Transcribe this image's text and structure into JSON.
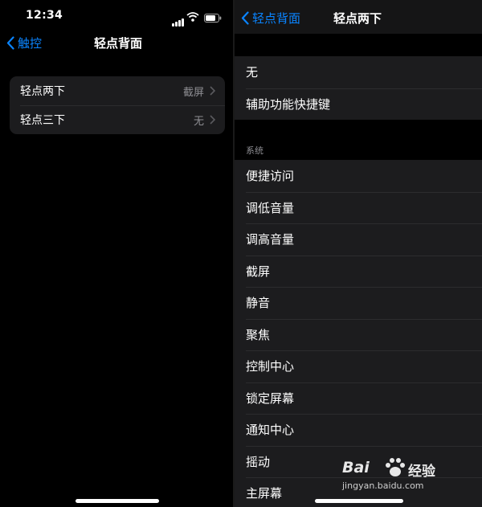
{
  "left": {
    "status": {
      "time": "12:34"
    },
    "nav": {
      "back_label": "触控",
      "title": "轻点背面"
    },
    "rows": [
      {
        "label": "轻点两下",
        "value": "截屏"
      },
      {
        "label": "轻点三下",
        "value": "无"
      }
    ]
  },
  "right": {
    "nav": {
      "back_label": "轻点背面",
      "title": "轻点两下"
    },
    "top_options": [
      "无",
      "辅助功能快捷键"
    ],
    "section_header": "系统",
    "system_options": [
      "便捷访问",
      "调低音量",
      "调高音量",
      "截屏",
      "静音",
      "聚焦",
      "控制中心",
      "锁定屏幕",
      "通知中心",
      "摇动",
      "主屏幕"
    ]
  },
  "watermark": {
    "logo": "Bai",
    "logo_suffix": "经验",
    "url": "jingyan.baidu.com"
  },
  "colors": {
    "accent": "#0a84ff",
    "cell_bg": "#1c1c1e",
    "secondary_text": "#8e8e93"
  }
}
